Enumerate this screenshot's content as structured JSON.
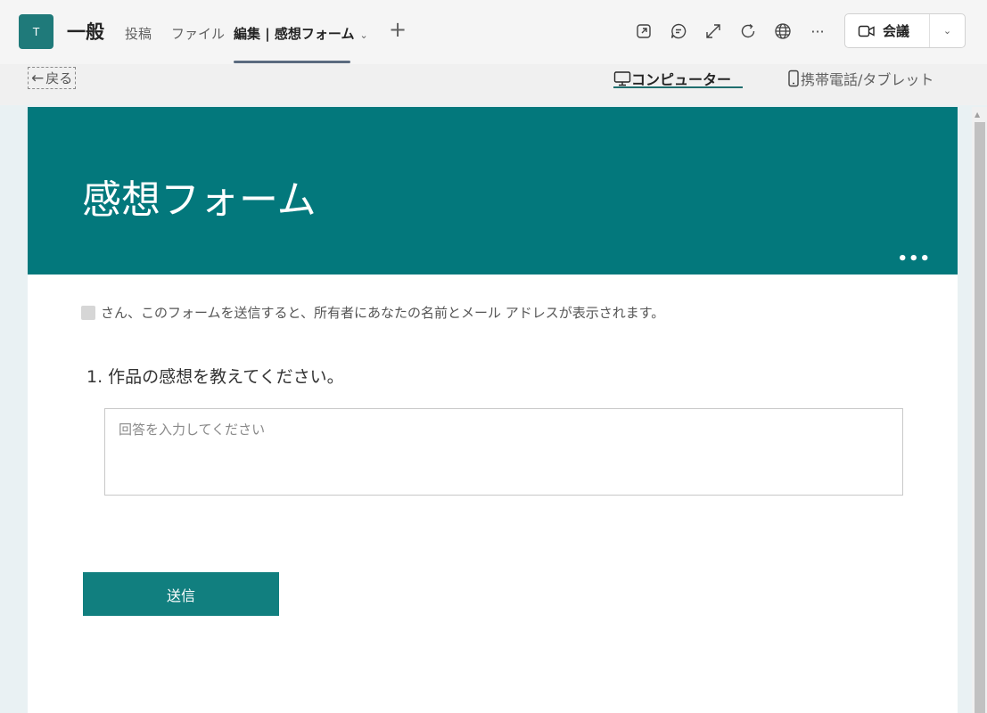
{
  "header": {
    "team_initial": "T",
    "channel_title": "一般",
    "tabs": [
      {
        "label": "投稿"
      },
      {
        "label": "ファイル"
      },
      {
        "label": "編集 | 感想フォーム"
      }
    ],
    "add_tab_label": "+",
    "more_label": "···",
    "meet_label": "会議",
    "icons": [
      "popout-icon",
      "chat-icon",
      "expand-icon",
      "refresh-icon",
      "globe-icon",
      "more-icon",
      "video-icon",
      "chevron-down-icon"
    ]
  },
  "subbar": {
    "back_label": "戻る",
    "computer_label": "コンピューター",
    "mobile_label": "携帯電話/タブレット"
  },
  "form": {
    "title": "感想フォーム",
    "more_label": "•••",
    "notice": "さん、このフォームを送信すると、所有者にあなたの名前とメール アドレスが表示されます。",
    "question": "1. 作品の感想を教えてください。",
    "answer_placeholder": "回答を入力してください",
    "answer_value": "",
    "submit_label": "送信"
  },
  "colors": {
    "banner": "#03787c",
    "submit": "#117f7f",
    "avatar": "#1f7a7a"
  }
}
